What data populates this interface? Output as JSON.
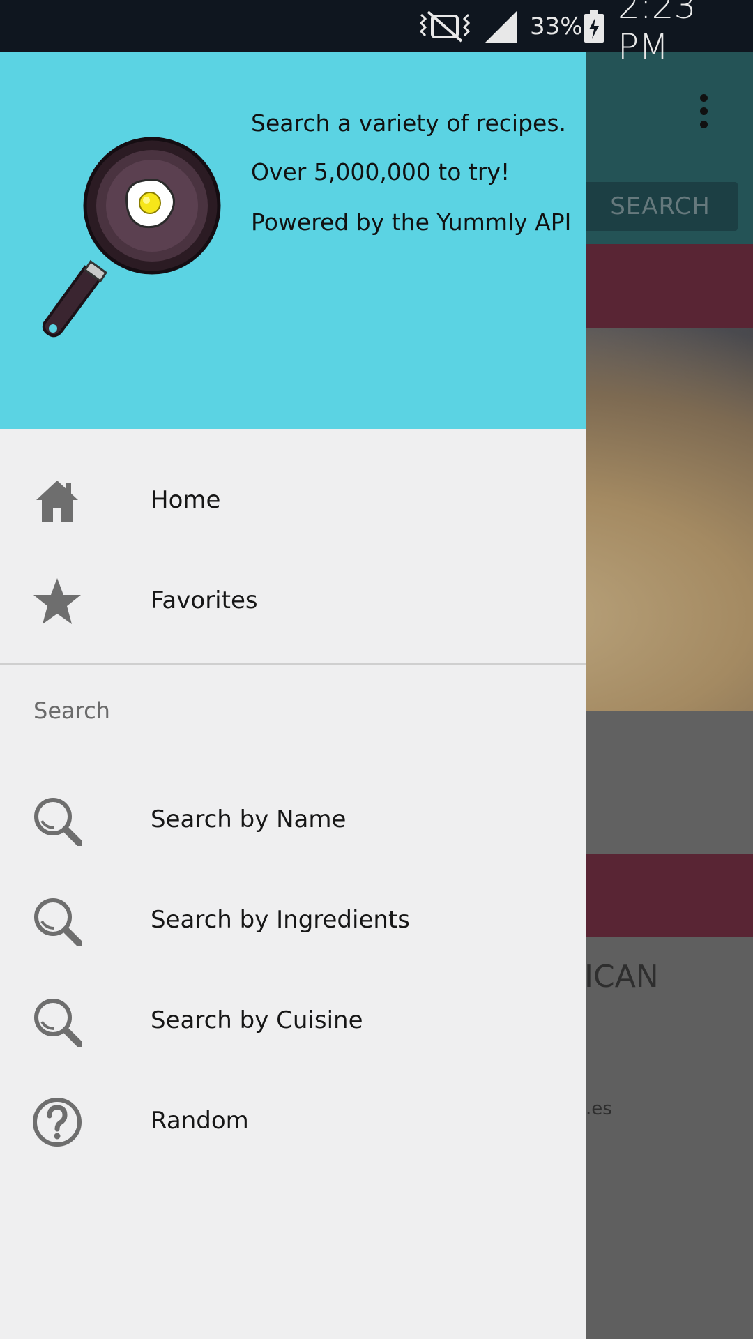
{
  "status_bar": {
    "battery_percent": "33%",
    "time": "2:23 PM",
    "icons": [
      "mute-icon",
      "signal-icon",
      "battery-charging-icon"
    ]
  },
  "background_app": {
    "search_button": "SEARCH",
    "card_text": "ICAN",
    "card_subtext": ".es"
  },
  "drawer": {
    "header": {
      "taglines": [
        "Search a variety of recipes.",
        "Over 5,000,000 to try!",
        "Powered by the Yummly API"
      ],
      "colors": {
        "header_bg": "#5bd3e3",
        "pan": "#3a2530"
      }
    },
    "items": [
      {
        "label": "Home",
        "icon": "home-icon"
      },
      {
        "label": "Favorites",
        "icon": "star-icon"
      }
    ],
    "section_title": "Search",
    "search_items": [
      {
        "label": "Search by Name",
        "icon": "search-icon"
      },
      {
        "label": "Search by Ingredients",
        "icon": "search-icon"
      },
      {
        "label": "Search by Cuisine",
        "icon": "search-icon"
      },
      {
        "label": "Random",
        "icon": "help-circle-icon"
      }
    ]
  }
}
